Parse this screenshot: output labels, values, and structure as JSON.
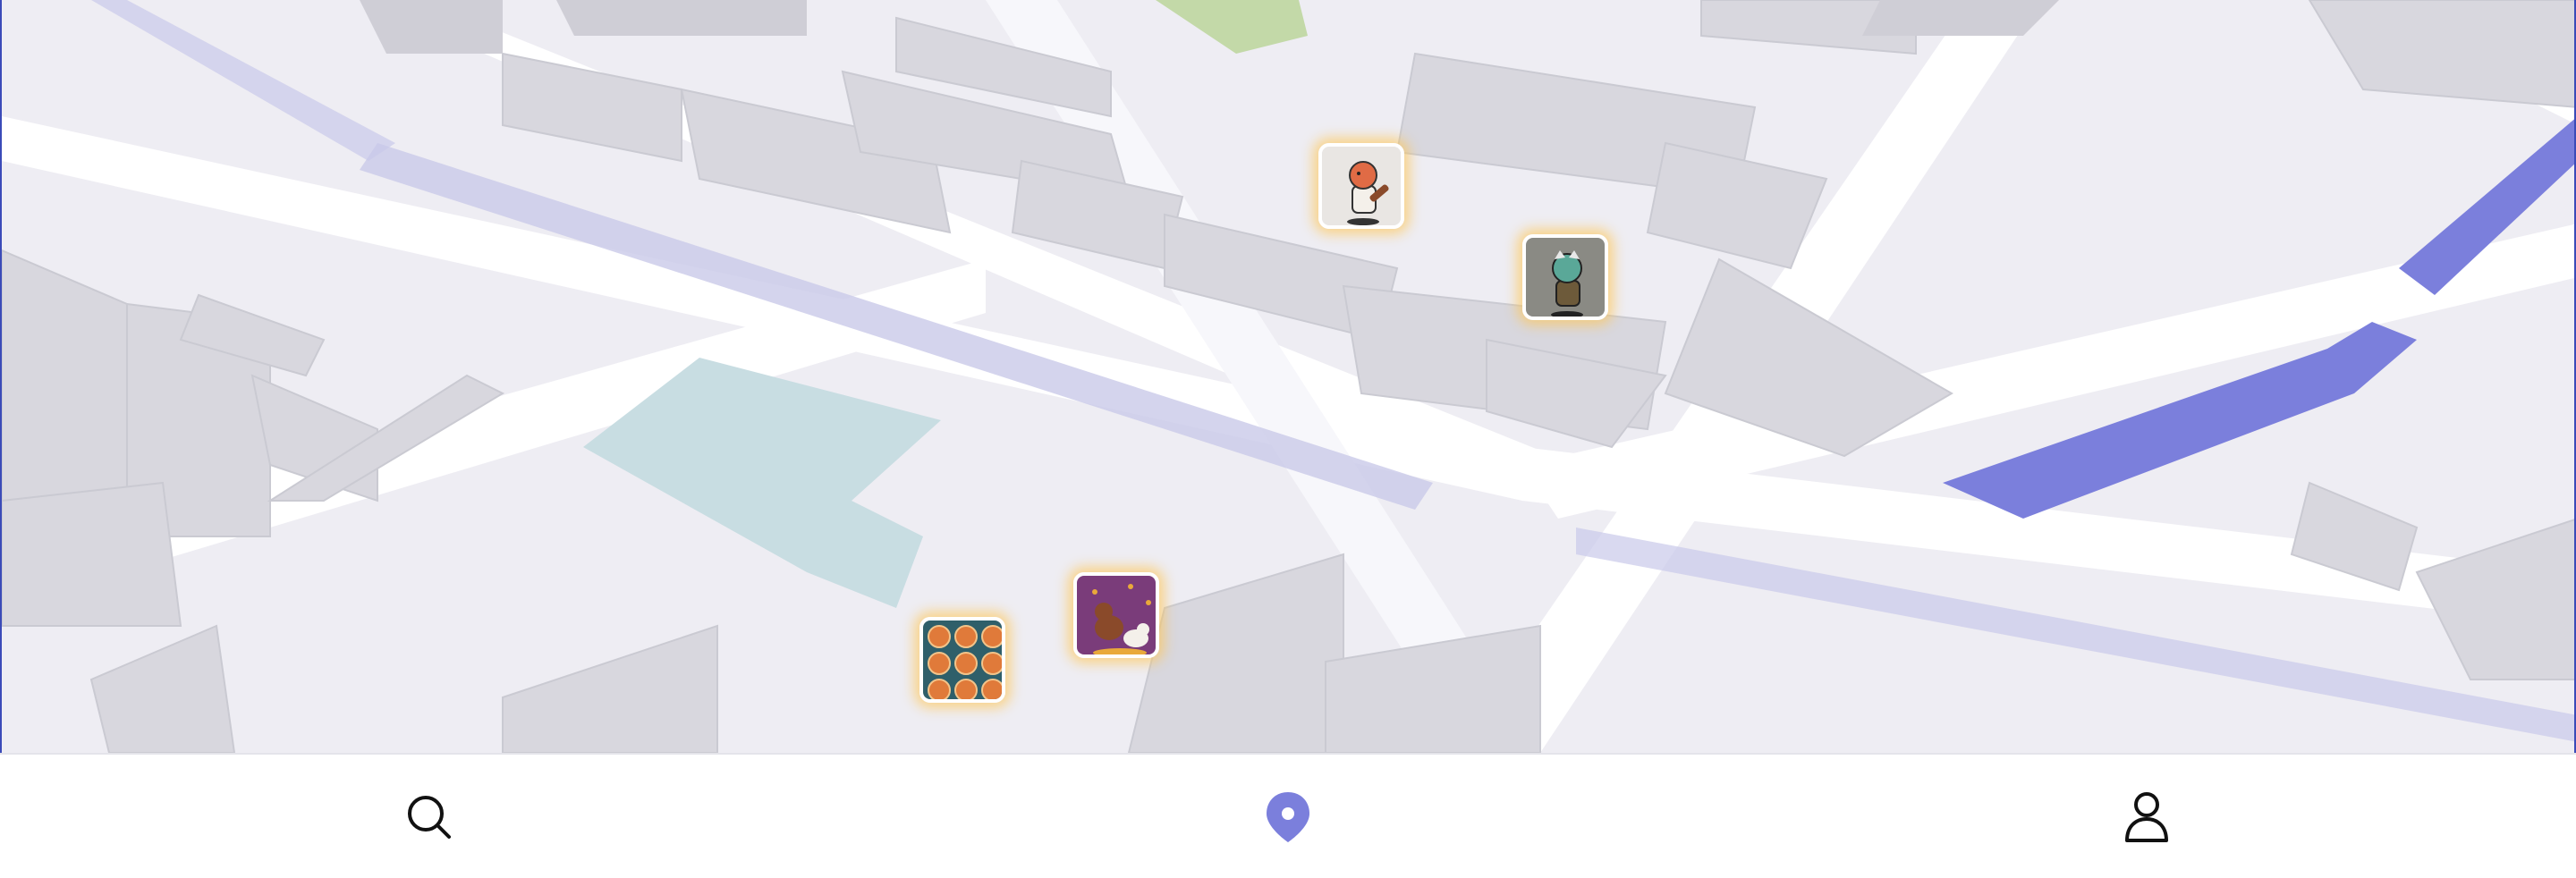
{
  "map": {
    "view": "3d-buildings",
    "accent_color": "#7b7fdc",
    "water_color": "#c8dde2",
    "park_color": "#c3d9a8",
    "markers": [
      {
        "id": "mascot-guitar",
        "icon": "orange-mascot-with-guitar-sticker",
        "bg": "#e9e6e3"
      },
      {
        "id": "mascot-backpack",
        "icon": "green-mascot-with-backpack-sticker",
        "bg": "#8a8a84"
      },
      {
        "id": "dog-cat-art",
        "icon": "dog-and-cat-illustration-sticker",
        "bg": "#7a3c7a"
      },
      {
        "id": "pizza-grid",
        "icon": "pizza-grid-sticker",
        "bg": "#2f5f6a"
      }
    ]
  },
  "navbar": {
    "active_color": "#7b7fdc",
    "items": [
      {
        "id": "search",
        "icon": "search-icon",
        "label": ""
      },
      {
        "id": "map",
        "icon": "location-pin-icon",
        "label": "",
        "active": true
      },
      {
        "id": "profile",
        "icon": "person-icon",
        "label": ""
      }
    ]
  }
}
